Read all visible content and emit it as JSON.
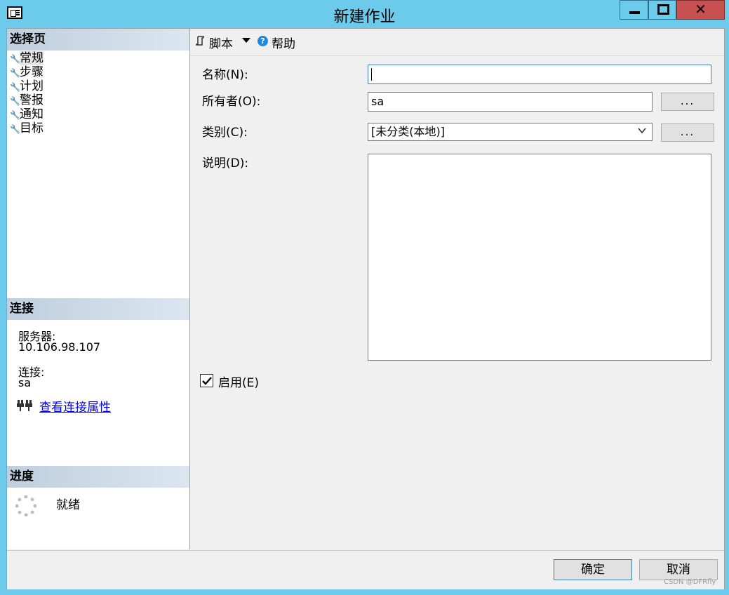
{
  "window": {
    "title": "新建作业"
  },
  "left_pane": {
    "pages_header": "选择页",
    "pages": [
      {
        "label": "常规",
        "selected": true
      },
      {
        "label": "步骤"
      },
      {
        "label": "计划"
      },
      {
        "label": "警报"
      },
      {
        "label": "通知"
      },
      {
        "label": "目标"
      }
    ],
    "connection_header": "连接",
    "server_label": "服务器:",
    "server_value": "10.106.98.107",
    "connection_label": "连接:",
    "connection_value": "sa",
    "view_connection_link": "查看连接属性",
    "progress_header": "进度",
    "progress_status": "就绪"
  },
  "toolbar": {
    "script_label": "脚本",
    "help_label": "帮助"
  },
  "form": {
    "name_label": "名称(N):",
    "name_value": "",
    "owner_label": "所有者(O):",
    "owner_value": "sa",
    "category_label": "类别(C):",
    "category_value": "[未分类(本地)]",
    "description_label": "说明(D):",
    "description_value": "",
    "ellipsis_label": "...",
    "enabled_label": "启用(E)",
    "enabled_checked": true
  },
  "buttons": {
    "ok_label": "确定",
    "cancel_label": "取消"
  },
  "watermark": "CSDN @DFRfly"
}
